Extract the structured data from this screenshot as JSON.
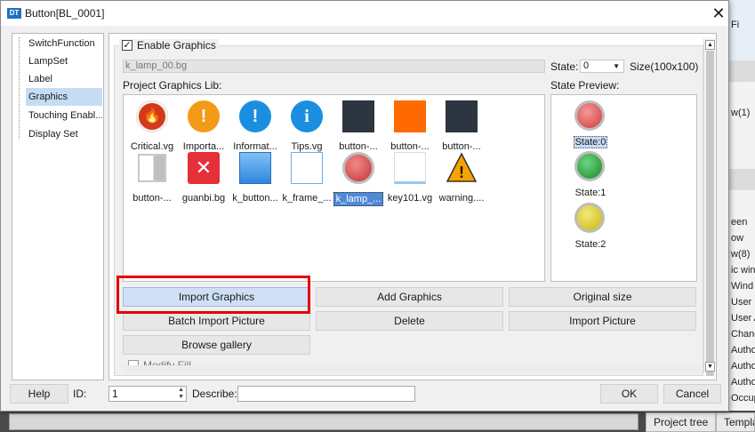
{
  "background": {
    "right_lines": [
      "Fi",
      "w(1)",
      "een",
      "ow",
      "w(8)",
      "ic wind",
      "Wind",
      "User P",
      "User A",
      "Chang",
      "Autho",
      "Autho",
      "Autho",
      "Occup"
    ],
    "bottom_tabs": [
      "Project tree",
      "Templa"
    ]
  },
  "dialog": {
    "title": "Button[BL_0001]",
    "close_glyph": "✕",
    "logo_text": "DT",
    "nav_items": [
      "SwitchFunction",
      "LampSet",
      "Label",
      "Graphics",
      "Touching Enabl...",
      "Display Set"
    ],
    "selected_nav": "Graphics",
    "enable_graphics": {
      "label": "Enable Graphics",
      "checked": true,
      "check_glyph": "✓"
    },
    "graphic_path": "k_lamp_00.bg",
    "state_label": "State:",
    "state_value": "0",
    "size_text": "Size(100x100)",
    "lib_label": "Project Graphics Lib:",
    "preview_label": "State Preview:",
    "graphics": [
      {
        "caption": "Critical.vg",
        "icon": "fire-icon",
        "glyph": "🔥",
        "color": "#d23a1c"
      },
      {
        "caption": "Importa...",
        "icon": "exclamation-icon",
        "glyph": "!",
        "color": "#f39a17"
      },
      {
        "caption": "Informat...",
        "icon": "exclamation-icon",
        "glyph": "!",
        "color": "#1a8fe0"
      },
      {
        "caption": "Tips.vg",
        "icon": "info-icon",
        "glyph": "i",
        "color": "#1a8fe0"
      },
      {
        "caption": "button-...",
        "icon": "dark-square-icon",
        "color": "#2d3540"
      },
      {
        "caption": "button-...",
        "icon": "orange-square-icon",
        "color": "#ff6a00"
      },
      {
        "caption": "button-...",
        "icon": "dark-square-icon",
        "color": "#2d3540"
      },
      {
        "caption": "button-...",
        "icon": "half-gray-button-icon",
        "color": "#bdbdbd"
      },
      {
        "caption": "guanbi.bg",
        "icon": "close-x-icon",
        "glyph": "✕",
        "color": "#e5303a"
      },
      {
        "caption": "k_button...",
        "icon": "blue-button-icon",
        "color": "#4a9ee8"
      },
      {
        "caption": "k_frame_...",
        "icon": "frame-icon",
        "color": "#6aaee8"
      },
      {
        "caption": "k_lamp_...",
        "icon": "red-lamp-icon",
        "color": "#d24646",
        "selected": true
      },
      {
        "caption": "key101.vg",
        "icon": "key-frame-icon",
        "color": "#9ec6ea"
      },
      {
        "caption": "warning....",
        "icon": "warning-icon",
        "glyph": "!",
        "color": "#f5a300"
      }
    ],
    "states": [
      {
        "label": "State:0",
        "color": "#d84a4a",
        "selected": true
      },
      {
        "label": "State:1",
        "color": "#1f9c35"
      },
      {
        "label": "State:2",
        "color": "#d8c41a"
      }
    ],
    "buttons": {
      "import_graphics": "Import Graphics",
      "add_graphics": "Add Graphics",
      "original_size": "Original size",
      "batch_import": "Batch Import Picture",
      "delete": "Delete",
      "import_picture": "Import Picture",
      "browse_gallery": "Browse gallery"
    },
    "modify_fill": {
      "label": "Modify Fill",
      "checked": false
    },
    "footer": {
      "help": "Help",
      "id_label": "ID:",
      "id_value": "1",
      "describe_label": "Describe:",
      "describe_value": "",
      "ok": "OK",
      "cancel": "Cancel"
    },
    "highlight_color": "#e30000"
  }
}
